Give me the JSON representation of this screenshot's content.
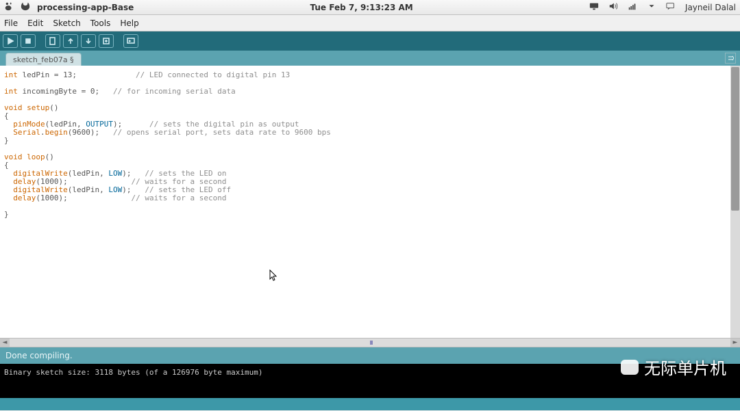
{
  "os": {
    "app_title": "processing-app-Base",
    "clock": "Tue Feb  7, 9:13:23 AM",
    "user": "Jayneil Dalal"
  },
  "menu": {
    "file": "File",
    "edit": "Edit",
    "sketch": "Sketch",
    "tools": "Tools",
    "help": "Help"
  },
  "tab": {
    "name": "sketch_feb07a §"
  },
  "code": {
    "l1a": "int",
    "l1b": " ledPin = 13;",
    "l1c": "             // LED connected to digital pin 13",
    "l2": "",
    "l3a": "int",
    "l3b": " incomingByte = 0;",
    "l3c": "   // for incoming serial data",
    "l4": "",
    "l5a": "void ",
    "l5b": "setup",
    "l5c": "()",
    "l6": "{",
    "l7a": "  ",
    "l7b": "pinMode",
    "l7c": "(ledPin, ",
    "l7d": "OUTPUT",
    "l7e": ");",
    "l7f": "      // sets the digital pin as output",
    "l8a": "  ",
    "l8b": "Serial",
    "l8c": ".",
    "l8d": "begin",
    "l8e": "(9600);",
    "l8f": "   // opens serial port, sets data rate to 9600 bps",
    "l9": "}",
    "l10": "",
    "l11a": "void ",
    "l11b": "loop",
    "l11c": "()",
    "l12": "{",
    "l13a": "  ",
    "l13b": "digitalWrite",
    "l13c": "(ledPin, ",
    "l13d": "LOW",
    "l13e": ");",
    "l13f": "   // sets the LED on",
    "l14a": "  ",
    "l14b": "delay",
    "l14c": "(1000);",
    "l14f": "              // waits for a second",
    "l15a": "  ",
    "l15b": "digitalWrite",
    "l15c": "(ledPin, ",
    "l15d": "LOW",
    "l15e": ");",
    "l15f": "   // sets the LED off",
    "l16a": "  ",
    "l16b": "delay",
    "l16c": "(1000);",
    "l16f": "              // waits for a second",
    "l17": "",
    "l18": "}"
  },
  "status": {
    "text": "Done compiling."
  },
  "console": {
    "line": "Binary sketch size: 3118 bytes (of a 126976 byte maximum)"
  },
  "footer": {
    "text": ""
  },
  "watermark": {
    "text": "无际单片机"
  }
}
